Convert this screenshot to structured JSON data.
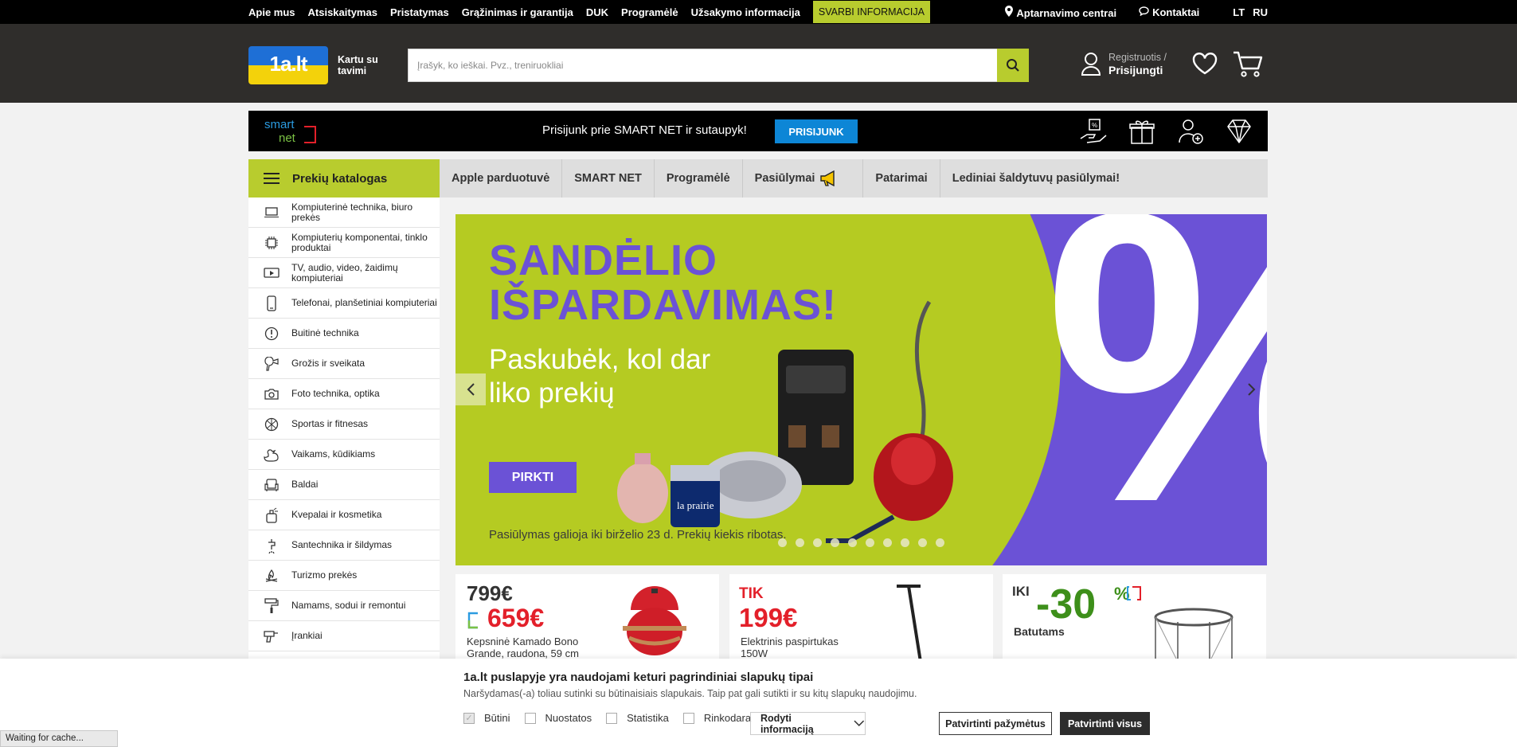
{
  "topbar": {
    "links": [
      "Apie mus",
      "Atsiskaitymas",
      "Pristatymas",
      "Grąžinimas ir garantija",
      "DUK",
      "Programėlė",
      "Užsakymo informacija"
    ],
    "important": "SVARBI INFORMACIJA",
    "service_centers": "Aptarnavimo centrai",
    "contacts": "Kontaktai",
    "lang_lt": "LT",
    "lang_ru": "RU"
  },
  "header": {
    "logo_text": "1a.lt",
    "tagline": "Kartu su tavimi",
    "search_placeholder": "Įrašyk, ko ieškai. Pvz., treniruokliai",
    "register": "Registruotis /",
    "login": "Prisijungti"
  },
  "smartnet": {
    "logo_line1": "smart",
    "logo_line2": "net",
    "promo": "Prisijunk prie SMART NET ir sutaupyk!",
    "join": "PRISIJUNK"
  },
  "catalog": {
    "title": "Prekių katalogas",
    "items": [
      {
        "label": "Kompiuterinė technika, biuro prekės",
        "icon": "laptop-icon"
      },
      {
        "label": "Kompiuterių komponentai, tinklo produktai",
        "icon": "chip-icon"
      },
      {
        "label": "TV, audio, video, žaidimų kompiuteriai",
        "icon": "tv-icon"
      },
      {
        "label": "Telefonai, planšetiniai kompiuteriai",
        "icon": "phone-icon"
      },
      {
        "label": "Buitinė technika",
        "icon": "appliance-icon"
      },
      {
        "label": "Grožis ir sveikata",
        "icon": "hairdryer-icon"
      },
      {
        "label": "Foto technika, optika",
        "icon": "camera-icon"
      },
      {
        "label": "Sportas ir fitnesas",
        "icon": "ball-icon"
      },
      {
        "label": "Vaikams, kūdikiams",
        "icon": "duck-icon"
      },
      {
        "label": "Baldai",
        "icon": "armchair-icon"
      },
      {
        "label": "Kvepalai ir kosmetika",
        "icon": "perfume-icon"
      },
      {
        "label": "Santechnika ir šildymas",
        "icon": "faucet-icon"
      },
      {
        "label": "Turizmo prekės",
        "icon": "campfire-icon"
      },
      {
        "label": "Namams, sodui ir remontui",
        "icon": "paint-roller-icon"
      },
      {
        "label": "Įrankiai",
        "icon": "drill-icon"
      }
    ]
  },
  "mainnav": [
    "Apple parduotuvė",
    "SMART NET",
    "Programėlė",
    "Pasiūlymai",
    "Patarimai",
    "Lediniai šaldytuvų pasiūlymai!"
  ],
  "banner": {
    "headline1": "SANDĖLIO",
    "headline2": "IŠPARDAVIMAS!",
    "sub1": "Paskubėk, kol dar",
    "sub2": "liko prekių",
    "cta": "PIRKTI",
    "fine_print": "Pasiūlymas galioja iki birželio 23 d. Prekių kiekis ribotas.",
    "big_symbol": "%",
    "slide_count": 10,
    "product_label": "la prairie"
  },
  "cards": [
    {
      "old_price": "799€",
      "new_price": "659€",
      "name": "Kepsninė Kamado Bono Grande, raudona, 59 cm"
    },
    {
      "tik": "TIK",
      "price": "199€",
      "name": "Elektrinis paspirtukas 150W"
    },
    {
      "iki": "IKI",
      "big": "-30",
      "pct": "%",
      "name": "Batutams"
    }
  ],
  "cookie": {
    "title": "1a.lt puslapyje yra naudojami keturi pagrindiniai slapukų tipai",
    "desc": "Naršydamas(-a) toliau sutinki su būtinaisiais slapukais. Taip pat gali sutikti ir su kitų slapukų naudojimu.",
    "options": [
      "Būtini",
      "Nuostatos",
      "Statistika",
      "Rinkodara"
    ],
    "details": "Rodyti informaciją",
    "confirm_selected": "Patvirtinti pažymėtus",
    "confirm_all": "Patvirtinti visus"
  },
  "status": "Waiting for cache...",
  "colors": {
    "accent": "#b8cc2e",
    "purple": "#6b52d6",
    "red": "#e3202a",
    "header": "#2f2d2b"
  }
}
